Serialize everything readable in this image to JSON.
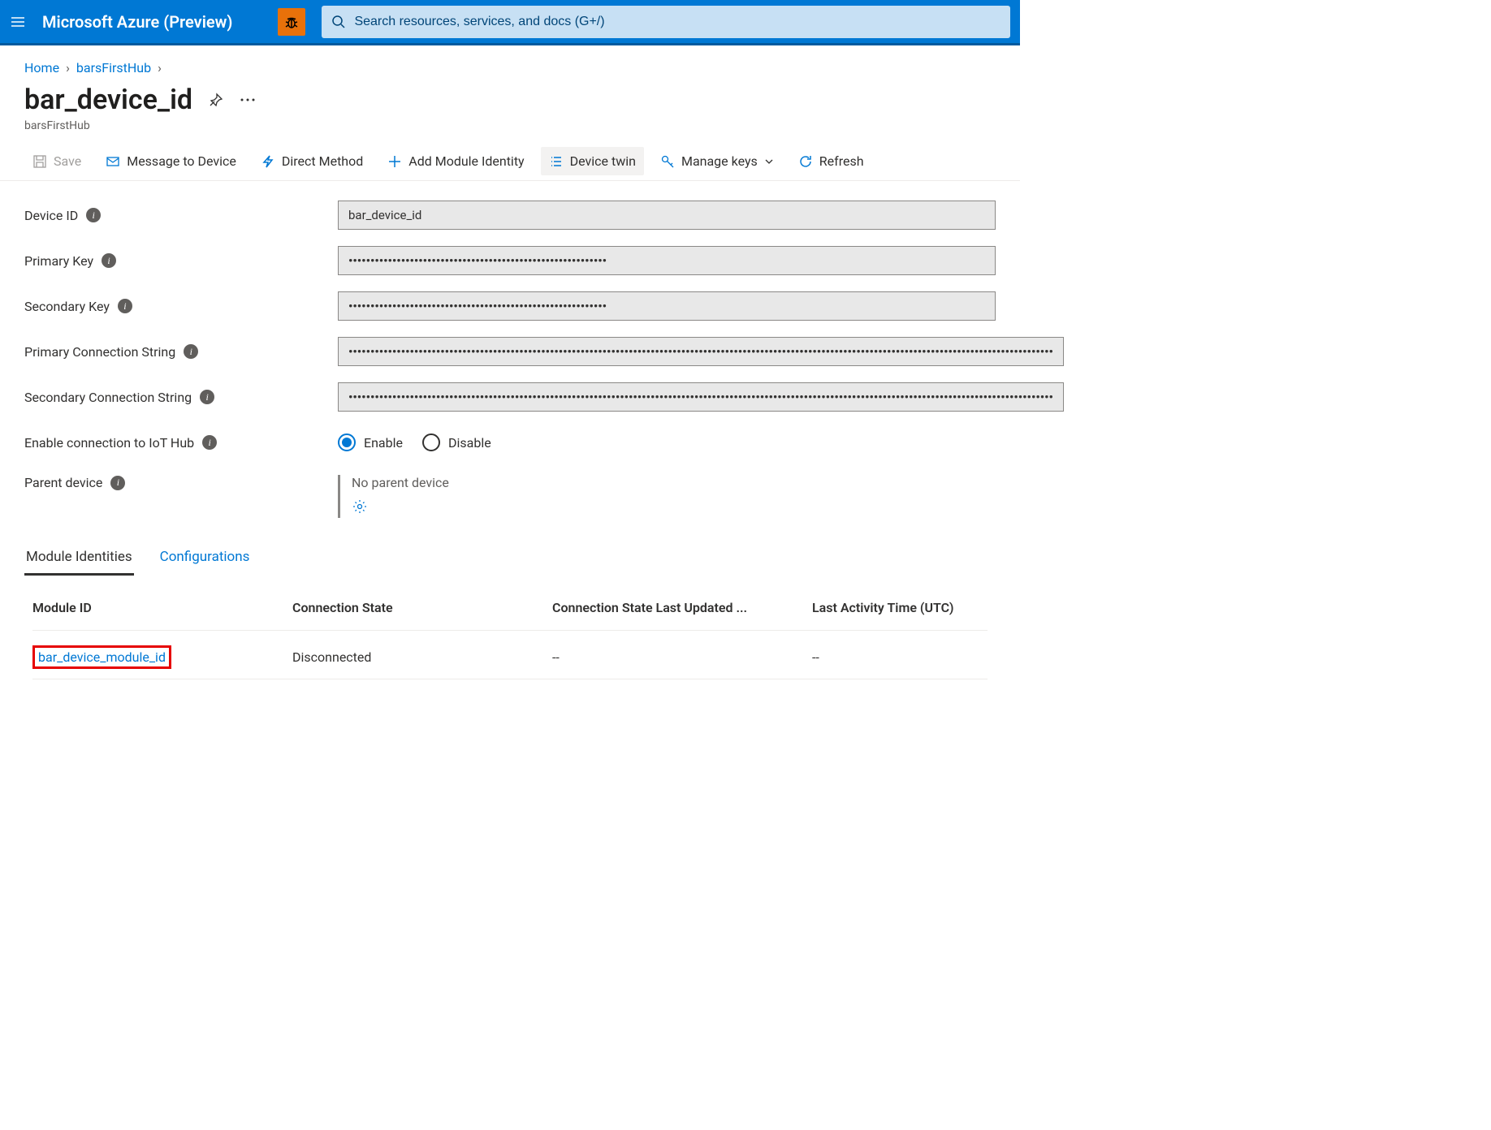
{
  "header": {
    "brand": "Microsoft Azure (Preview)",
    "search_placeholder": "Search resources, services, and docs (G+/)"
  },
  "breadcrumb": {
    "items": [
      "Home",
      "barsFirstHub"
    ]
  },
  "page": {
    "title": "bar_device_id",
    "subtitle": "barsFirstHub"
  },
  "toolbar": {
    "save": "Save",
    "message": "Message to Device",
    "direct_method": "Direct Method",
    "add_module": "Add Module Identity",
    "device_twin": "Device twin",
    "manage_keys": "Manage keys",
    "refresh": "Refresh"
  },
  "fields": {
    "device_id": {
      "label": "Device ID",
      "value": "bar_device_id"
    },
    "primary_key": {
      "label": "Primary Key",
      "value": "•••••••••••••••••••••••••••••••••••••••••••••••••••••••••••"
    },
    "secondary_key": {
      "label": "Secondary Key",
      "value": "•••••••••••••••••••••••••••••••••••••••••••••••••••••••••••"
    },
    "primary_conn": {
      "label": "Primary Connection String",
      "value": "•••••••••••••••••••••••••••••••••••••••••••••••••••••••••••••••••••••••••••••••••••••••••••••••••••••••••••••••••••••••••••••••••••••••••••••••••••••••••••••••••"
    },
    "secondary_conn": {
      "label": "Secondary Connection String",
      "value": "•••••••••••••••••••••••••••••••••••••••••••••••••••••••••••••••••••••••••••••••••••••••••••••••••••••••••••••••••••••••••••••••••••••••••••••••••••••••••••••••••"
    },
    "enable_iot": {
      "label": "Enable connection to IoT Hub",
      "enable": "Enable",
      "disable": "Disable"
    },
    "parent_device": {
      "label": "Parent device",
      "value": "No parent device"
    }
  },
  "tabs": {
    "modules": "Module Identities",
    "configs": "Configurations"
  },
  "table": {
    "columns": [
      "Module ID",
      "Connection State",
      "Connection State Last Updated ...",
      "Last Activity Time (UTC)"
    ],
    "rows": [
      {
        "module_id": "bar_device_module_id",
        "conn_state": "Disconnected",
        "conn_updated": "--",
        "last_activity": "--"
      }
    ]
  }
}
